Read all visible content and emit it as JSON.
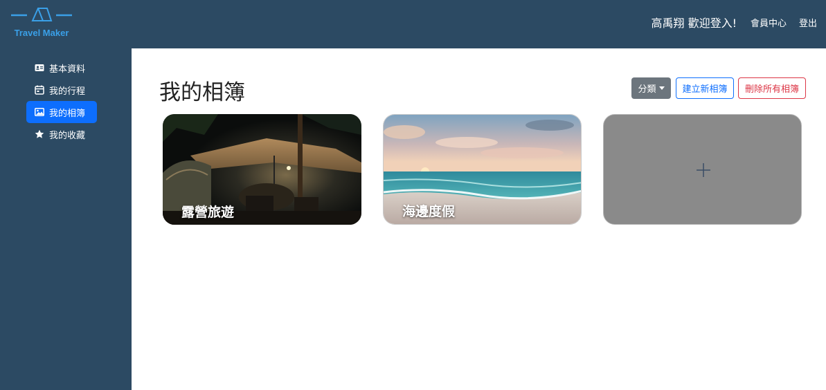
{
  "brand": {
    "name": "Travel Maker"
  },
  "header": {
    "welcome": "高禹翔 歡迎登入!",
    "member_center": "會員中心",
    "logout": "登出"
  },
  "sidebar": {
    "items": [
      {
        "label": "基本資料",
        "icon": "id-card-icon"
      },
      {
        "label": "我的行程",
        "icon": "calendar-icon"
      },
      {
        "label": "我的相簿",
        "icon": "image-icon",
        "active": true
      },
      {
        "label": "我的收藏",
        "icon": "star-icon"
      }
    ]
  },
  "main": {
    "title": "我的相簿",
    "category_button": "分類",
    "create_button": "建立新相簿",
    "delete_all_button": "刪除所有相簿",
    "albums": [
      {
        "title": "露營旅遊"
      },
      {
        "title": "海邊度假"
      }
    ],
    "add_album_icon": "plus-icon"
  },
  "colors": {
    "navbar": "#2c4a63",
    "primary": "#0d6efd",
    "danger": "#dc3545",
    "secondary": "#6c757d",
    "logo": "#3aa0e8"
  }
}
